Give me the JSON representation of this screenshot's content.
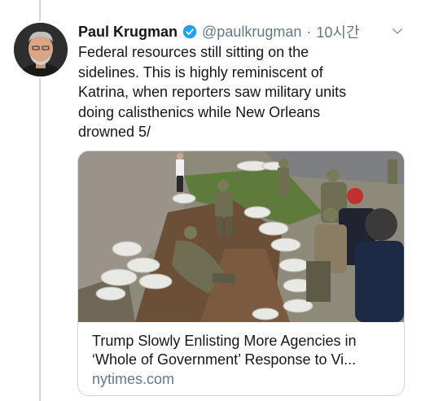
{
  "tweet": {
    "author_name": "Paul Krugman",
    "handle": "@paulkrugman",
    "time": "10시간",
    "text": "Federal resources still sitting on the\nsidelines. This is highly reminiscent of\nKatrina, when reporters saw military units\ndoing calisthenics while New Orleans\ndrowned 5/"
  },
  "card": {
    "title_line1": "Trump Slowly Enlisting More Agencies in",
    "title_line2": "‘Whole of Government’ Response to Vi...",
    "domain": "nytimes.com"
  },
  "colors": {
    "verified": "#1da1f2",
    "secondary_text": "#657786",
    "border": "#ccd6dd"
  },
  "icons": {
    "verified": "verified-badge-icon",
    "more": "chevron-down-icon"
  }
}
